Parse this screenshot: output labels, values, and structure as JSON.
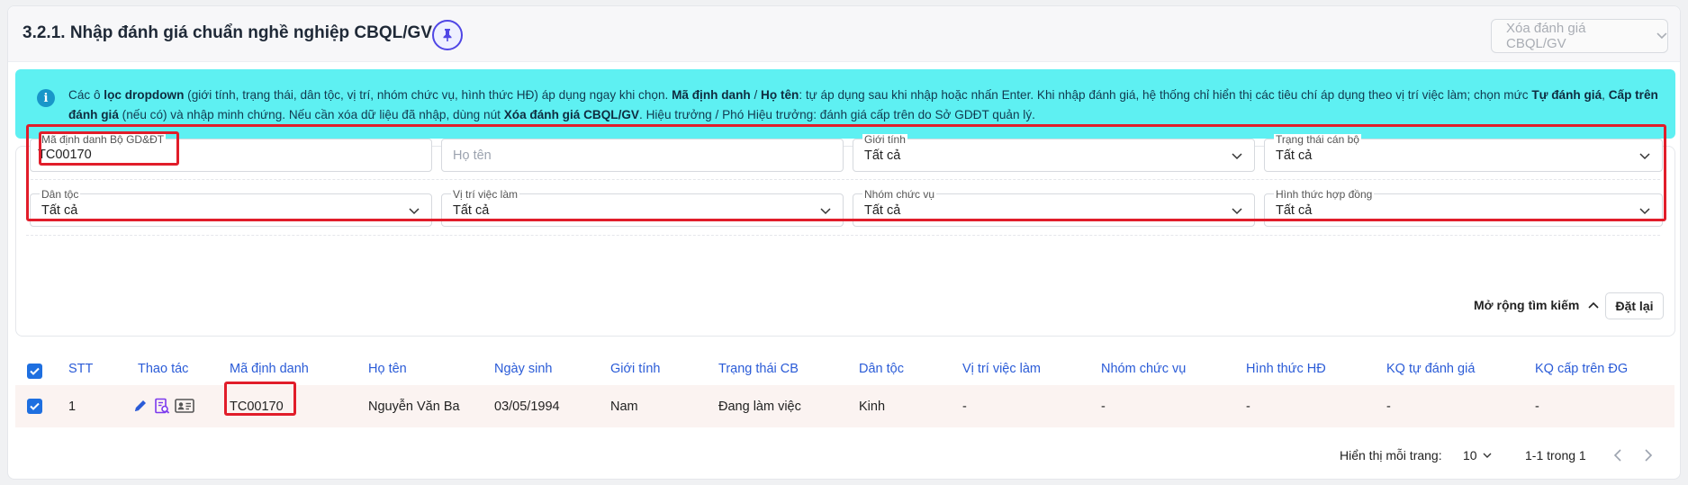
{
  "header": {
    "title": "3.2.1. Nhập đánh giá chuẩn nghề nghiệp CBQL/GV",
    "delete_label": "Xóa đánh giá CBQL/GV"
  },
  "info": {
    "t1": "Các ô ",
    "b1": "lọc dropdown",
    "t2": " (giới tính, trạng thái, dân tộc, vị trí, nhóm chức vụ, hình thức HĐ) áp dụng ngay khi chọn. ",
    "b2": "Mã định danh",
    "t3": " / ",
    "b3": "Họ tên",
    "t4": ": tự áp dụng sau khi nhập hoặc nhấn Enter. Khi nhập đánh giá, hệ thống chỉ hiển thị các tiêu chí áp dụng theo vị trí việc làm; chọn mức ",
    "b4": "Tự đánh giá",
    "t5": ", ",
    "b5": "Cấp trên đánh giá",
    "t6": " (nếu có) và nhập minh chứng. Nếu cần xóa dữ liệu đã nhập, dùng nút ",
    "b6": "Xóa đánh giá CBQL/GV",
    "t7": ". Hiệu trưởng / Phó Hiệu trưởng: đánh giá cấp trên do Sở GDĐT quản lý."
  },
  "filters": {
    "ma_dinh_danh": {
      "label": "Mã định danh Bộ GD&ĐT",
      "value": "TC00170"
    },
    "ho_ten": {
      "placeholder": "Họ tên"
    },
    "gioi_tinh": {
      "label": "Giới tính",
      "value": "Tất cả"
    },
    "trang_thai": {
      "label": "Trạng thái cán bộ",
      "value": "Tất cả"
    },
    "dan_toc": {
      "label": "Dân tộc",
      "value": "Tất cả"
    },
    "vi_tri": {
      "label": "Vị trí việc làm",
      "value": "Tất cả"
    },
    "nhom_chuc_vu": {
      "label": "Nhóm chức vụ",
      "value": "Tất cả"
    },
    "hinh_thuc": {
      "label": "Hình thức hợp đồng",
      "value": "Tất cả"
    },
    "expand_label": "Mở rộng tìm kiếm",
    "reset_label": "Đặt lại"
  },
  "table": {
    "columns": [
      "STT",
      "Thao tác",
      "Mã định danh",
      "Họ tên",
      "Ngày sinh",
      "Giới tính",
      "Trạng thái CB",
      "Dân tộc",
      "Vị trí việc làm",
      "Nhóm chức vụ",
      "Hình thức HĐ",
      "KQ tự đánh giá",
      "KQ cấp trên ĐG"
    ],
    "rows": [
      {
        "stt": "1",
        "ma": "TC00170",
        "ho_ten": "Nguyễn Văn Ba",
        "ngay_sinh": "03/05/1994",
        "gioi_tinh": "Nam",
        "trang_thai": "Đang làm việc",
        "dan_toc": "Kinh",
        "vi_tri": "-",
        "nhom": "-",
        "hinh_thuc": "-",
        "kq_tu": "-",
        "kq_cap_tren": "-"
      }
    ]
  },
  "pagination": {
    "per_page_label": "Hiển thị mỗi trang:",
    "per_page": "10",
    "range": "1-1 trong 1"
  },
  "colors": {
    "accent": "#1e6fe0",
    "info_bg": "#5ef0f2",
    "highlight": "#e11d2a",
    "pin": "#4f46e5"
  }
}
